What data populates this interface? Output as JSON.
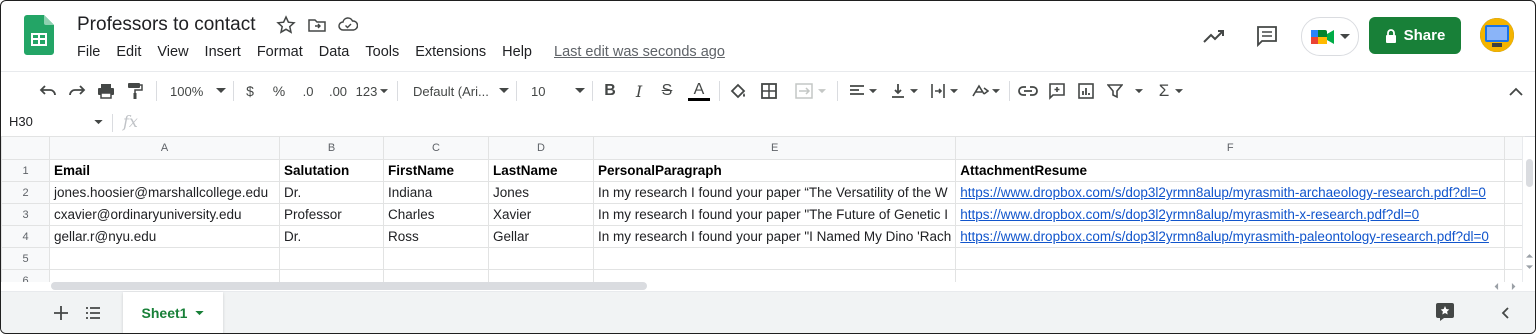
{
  "doc": {
    "title": "Professors to contact",
    "last_edit": "Last edit was seconds ago",
    "share_label": "Share"
  },
  "menu": [
    "File",
    "Edit",
    "View",
    "Insert",
    "Format",
    "Data",
    "Tools",
    "Extensions",
    "Help"
  ],
  "toolbar": {
    "zoom": "100%",
    "currency": "$",
    "percent": "%",
    "decrease_decimal": ".0",
    "increase_decimal": ".00",
    "more_formats": "123",
    "font": "Default (Ari...",
    "font_size": "10",
    "text_color": "#000000"
  },
  "formula_bar": {
    "name_box": "H30",
    "fx": "fx",
    "value": ""
  },
  "columns": [
    "A",
    "B",
    "C",
    "D",
    "E",
    "F"
  ],
  "rows": [
    {
      "num": "1",
      "cells": [
        "Email",
        "Salutation",
        "FirstName",
        "LastName",
        "PersonalParagraph",
        "AttachmentResume"
      ]
    },
    {
      "num": "2",
      "cells": [
        "jones.hoosier@marshallcollege.edu",
        "Dr.",
        "Indiana",
        "Jones",
        "In my research I found your paper “The Versatility of the W",
        "https://www.dropbox.com/s/dop3l2yrmn8alup/myrasmith-archaeology-research.pdf?dl=0"
      ]
    },
    {
      "num": "3",
      "cells": [
        "cxavier@ordinaryuniversity.edu",
        "Professor",
        "Charles",
        "Xavier",
        "In my research I found your paper \"The Future of Genetic I",
        "https://www.dropbox.com/s/dop3l2yrmn8alup/myrasmith-x-research.pdf?dl=0"
      ]
    },
    {
      "num": "4",
      "cells": [
        "gellar.r@nyu.edu",
        "Dr.",
        "Ross",
        "Gellar",
        "In my research I found your paper \"I Named My Dino 'Rach",
        "https://www.dropbox.com/s/dop3l2yrmn8alup/myrasmith-paleontology-research.pdf?dl=0"
      ]
    },
    {
      "num": "5",
      "cells": [
        "",
        "",
        "",
        "",
        "",
        ""
      ]
    },
    {
      "num": "6",
      "cells": [
        "",
        "",
        "",
        "",
        "",
        ""
      ]
    }
  ],
  "sheet_tabs": [
    {
      "label": "Sheet1",
      "active": true
    }
  ],
  "colors": {
    "brand_green": "#188038",
    "link": "#1155cc"
  }
}
